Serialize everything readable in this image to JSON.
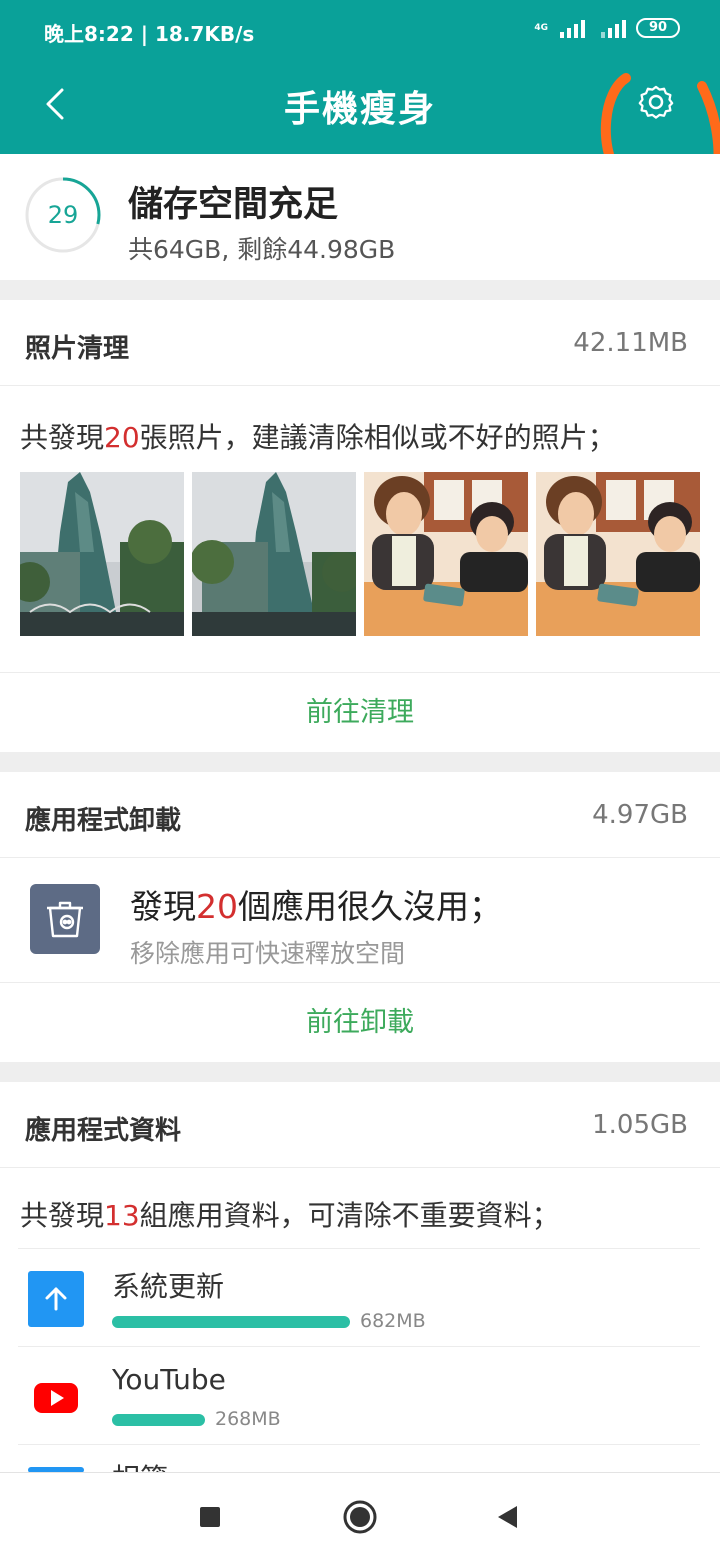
{
  "status": {
    "time": "晚上8:22",
    "speed": "18.7KB/s",
    "network": "4G",
    "battery": "90"
  },
  "header": {
    "title": "手機瘦身"
  },
  "summary": {
    "percent": "29",
    "title": "儲存空間充足",
    "subtitle": "共64GB, 剩餘44.98GB"
  },
  "photo_section": {
    "title": "照片清理",
    "size": "42.11MB",
    "desc_prefix": "共發現",
    "count": "20",
    "desc_suffix": "張照片，建議清除相似或不好的照片；",
    "action": "前往清理"
  },
  "uninstall_section": {
    "title": "應用程式卸載",
    "size": "4.97GB",
    "main_prefix": "發現",
    "count": "20",
    "main_suffix": "個應用很久沒用；",
    "sub": "移除應用可快速釋放空間",
    "action": "前往卸載"
  },
  "appdata_section": {
    "title": "應用程式資料",
    "size": "1.05GB",
    "desc_prefix": "共發現",
    "count": "13",
    "desc_suffix": "組應用資料，可清除不重要資料；",
    "items": [
      {
        "name": "系統更新",
        "size": "682MB",
        "fraction": 1.0,
        "icon": "arrow-up-icon",
        "color": "#2196f3"
      },
      {
        "name": "YouTube",
        "size": "268MB",
        "fraction": 0.39,
        "icon": "youtube-icon",
        "color": "#ff0000"
      },
      {
        "name": "相簿",
        "size": "",
        "fraction": 0.0,
        "icon": "album-icon",
        "color": "#2196f3"
      }
    ]
  },
  "colors": {
    "accent": "#0aa199",
    "action_green": "#3daa5c",
    "highlight_red": "#d32f2f",
    "bar_teal": "#2bbfa5",
    "annotation_orange": "#ff6a1a"
  }
}
